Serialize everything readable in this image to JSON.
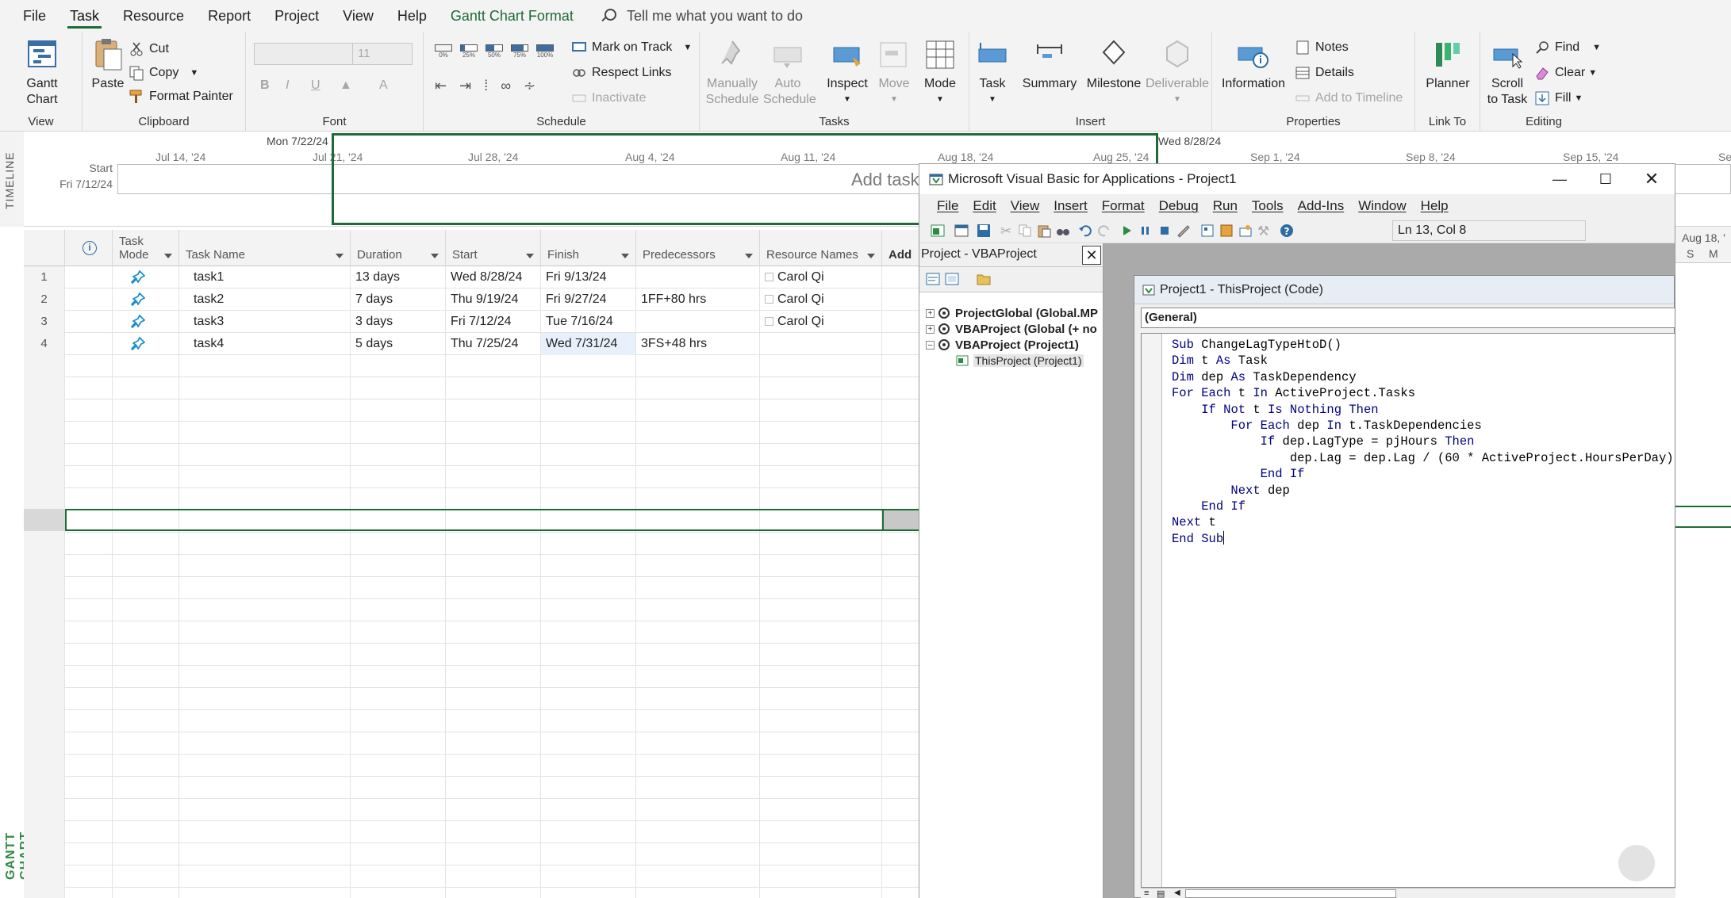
{
  "menu": {
    "items": [
      "File",
      "Task",
      "Resource",
      "Report",
      "Project",
      "View",
      "Help"
    ],
    "active": "Task",
    "contextual": "Gantt Chart Format",
    "tell_me": "Tell me what you want to do"
  },
  "ribbon": {
    "view": {
      "gantt_chart": "Gantt Chart",
      "label": "View"
    },
    "clipboard": {
      "paste": "Paste",
      "cut": "Cut",
      "copy": "Copy",
      "format_painter": "Format Painter",
      "label": "Clipboard"
    },
    "font": {
      "font_name": "",
      "font_size": "11",
      "bold": "B",
      "italic": "I",
      "underline": "U",
      "label": "Font"
    },
    "schedule": {
      "mark_on_track": "Mark on Track",
      "respect_links": "Respect Links",
      "inactivate": "Inactivate",
      "label": "Schedule",
      "percent": [
        "0%",
        "25%",
        "50%",
        "75%",
        "100%"
      ]
    },
    "tasks": {
      "manually_schedule": "Manually Schedule",
      "auto_schedule": "Auto Schedule",
      "inspect": "Inspect",
      "move": "Move",
      "mode": "Mode",
      "label": "Tasks"
    },
    "insert": {
      "task": "Task",
      "summary": "Summary",
      "milestone": "Milestone",
      "deliverable": "Deliverable",
      "label": "Insert"
    },
    "properties": {
      "information": "Information",
      "notes": "Notes",
      "details": "Details",
      "add_to_timeline": "Add to Timeline",
      "label": "Properties"
    },
    "link_to": {
      "planner": "Planner",
      "label": "Link To"
    },
    "editing": {
      "scroll_to_task": "Scroll to Task",
      "find": "Find",
      "clear": "Clear",
      "fill": "Fill",
      "label": "Editing"
    }
  },
  "timeline": {
    "side_label": "TIMELINE",
    "start_label": "Start",
    "start_date": "Fri 7/12/24",
    "today_label": "Mon 7/22/24",
    "finish_marker": "Wed 8/28/24",
    "ticks": [
      "Jul 14, '24",
      "Jul 21, '24",
      "Jul 28, '24",
      "Aug 4, '24",
      "Aug 11, '24",
      "Aug 18, '24",
      "Aug 25, '24",
      "Sep 1, '24",
      "Sep 8, '24",
      "Sep 15, '24",
      "Se"
    ],
    "placeholder": "Add tasks"
  },
  "gantt": {
    "side_label": "GANTT CHART",
    "columns": {
      "info": "i",
      "task_mode": "Task Mode",
      "task_name": "Task Name",
      "duration": "Duration",
      "start": "Start",
      "finish": "Finish",
      "predecessors": "Predecessors",
      "resource_names": "Resource Names",
      "add_column": "Add"
    },
    "rows": [
      {
        "id": "1",
        "name": "task1",
        "duration": "13 days",
        "start": "Wed 8/28/24",
        "finish": "Fri 9/13/24",
        "predecessors": "",
        "resource": "Carol Qi"
      },
      {
        "id": "2",
        "name": "task2",
        "duration": "7 days",
        "start": "Thu 9/19/24",
        "finish": "Fri 9/27/24",
        "predecessors": "1FF+80 hrs",
        "resource": "Carol Qi"
      },
      {
        "id": "3",
        "name": "task3",
        "duration": "3 days",
        "start": "Fri 7/12/24",
        "finish": "Tue 7/16/24",
        "predecessors": "",
        "resource": "Carol Qi"
      },
      {
        "id": "4",
        "name": "task4",
        "duration": "5 days",
        "start": "Thu 7/25/24",
        "finish": "Wed 7/31/24",
        "predecessors": "3FS+48 hrs",
        "resource": ""
      }
    ],
    "chart_header": {
      "date": "Aug 18, '",
      "days": [
        "S",
        "M"
      ]
    }
  },
  "vba": {
    "title": "Microsoft Visual Basic for Applications - Project1",
    "menu": [
      "File",
      "Edit",
      "View",
      "Insert",
      "Format",
      "Debug",
      "Run",
      "Tools",
      "Add-Ins",
      "Window",
      "Help"
    ],
    "position": "Ln 13, Col 8",
    "project_pane": {
      "title": "Project - VBAProject",
      "items": [
        "ProjectGlobal (Global.MP",
        "VBAProject (Global (+ no",
        "VBAProject (Project1)",
        "ThisProject (Project1)"
      ]
    },
    "code_window": {
      "title": "Project1 - ThisProject (Code)",
      "object_combo": "(General)",
      "lines": [
        "Sub ChangeLagTypeHtoD()",
        "Dim t As Task",
        "Dim dep As TaskDependency",
        "For Each t In ActiveProject.Tasks",
        "    If Not t Is Nothing Then",
        "        For Each dep In t.TaskDependencies",
        "            If dep.LagType = pjHours Then",
        "                dep.Lag = dep.Lag / (60 * ActiveProject.HoursPerDay)",
        "            End If",
        "        Next dep",
        "    End If",
        "Next t",
        "End Sub"
      ]
    }
  },
  "colors": {
    "accent": "#1f6b37",
    "pin": "#1a8fc9",
    "vba_keyword": "#00007f"
  }
}
